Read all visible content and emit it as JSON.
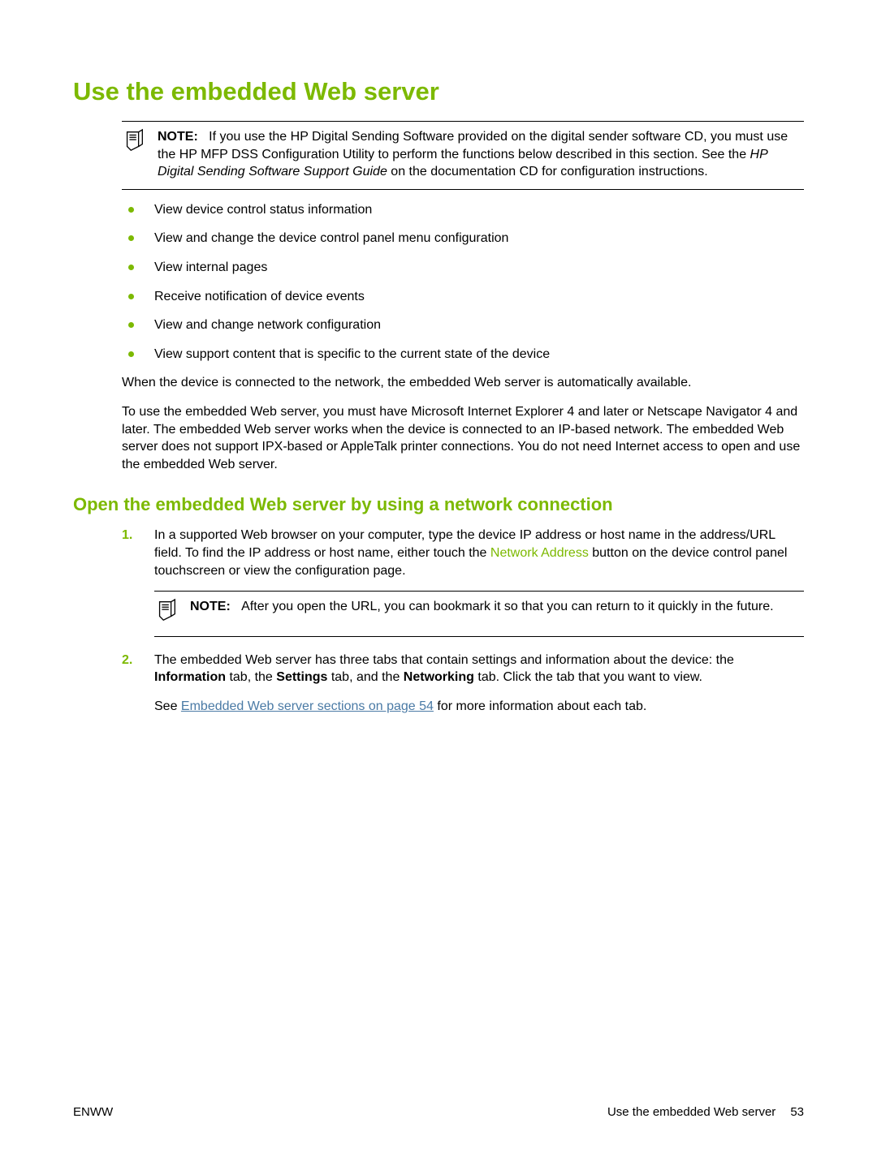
{
  "title": "Use the embedded Web server",
  "note1": {
    "label": "NOTE:",
    "pre": "If you use the HP Digital Sending Software provided on the digital sender software CD, you must use the HP MFP DSS Configuration Utility to perform the functions below described in this section. See the ",
    "italic": "HP Digital Sending Software Support Guide",
    "post": " on the documentation CD for configuration instructions."
  },
  "bullets": [
    "View device control status information",
    "View and change the device control panel menu configuration",
    "View internal pages",
    "Receive notification of device events",
    "View and change network configuration",
    "View support content that is specific to the current state of the device"
  ],
  "para1": "When the device is connected to the network, the embedded Web server is automatically available.",
  "para2": "To use the embedded Web server, you must have Microsoft Internet Explorer 4 and later or Netscape Navigator 4 and later. The embedded Web server works when the device is connected to an IP-based network. The embedded Web server does not support IPX-based or AppleTalk printer connections. You do not need Internet access to open and use the embedded Web server.",
  "subtitle": "Open the embedded Web server by using a network connection",
  "step1": {
    "num": "1.",
    "pre": "In a supported Web browser on your computer, type the device IP address or host name in the address/URL field. To find the IP address or host name, either touch the ",
    "green": "Network Address",
    "post": " button on the device control panel touchscreen or view the configuration page."
  },
  "step1_note": {
    "label": "NOTE:",
    "text": "After you open the URL, you can bookmark it so that you can return to it quickly in the future."
  },
  "step2": {
    "num": "2.",
    "pre": "The embedded Web server has three tabs that contain settings and information about the device: the ",
    "b1": "Information",
    "mid1": " tab, the ",
    "b2": "Settings",
    "mid2": " tab, and the ",
    "b3": "Networking",
    "post": " tab. Click the tab that you want to view."
  },
  "step2_tail": {
    "pre": "See ",
    "link": "Embedded Web server sections on page 54",
    "post": " for more information about each tab."
  },
  "footer": {
    "left": "ENWW",
    "rightText": "Use the embedded Web server",
    "pageNum": "53"
  }
}
